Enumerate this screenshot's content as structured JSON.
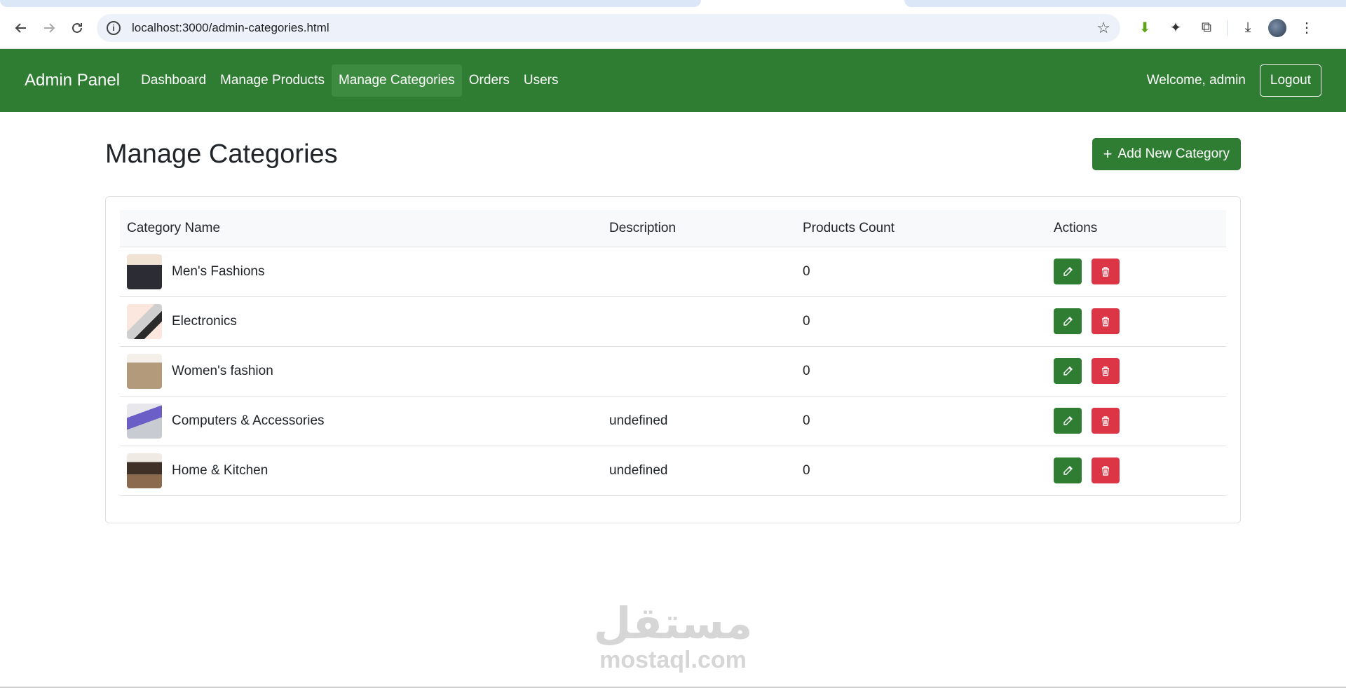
{
  "browser": {
    "url": "localhost:3000/admin-categories.html"
  },
  "navbar": {
    "brand": "Admin Panel",
    "links": [
      {
        "label": "Dashboard",
        "active": false
      },
      {
        "label": "Manage Products",
        "active": false
      },
      {
        "label": "Manage Categories",
        "active": true
      },
      {
        "label": "Orders",
        "active": false
      },
      {
        "label": "Users",
        "active": false
      }
    ],
    "welcome": "Welcome, admin",
    "logout_label": "Logout"
  },
  "page": {
    "title": "Manage Categories",
    "add_button_label": "Add New Category"
  },
  "table": {
    "headers": [
      "Category Name",
      "Description",
      "Products Count",
      "Actions"
    ],
    "rows": [
      {
        "name": "Men's Fashions",
        "description": "",
        "count": "0"
      },
      {
        "name": "Electronics",
        "description": "",
        "count": "0"
      },
      {
        "name": "Women's fashion",
        "description": "",
        "count": "0"
      },
      {
        "name": "Computers & Accessories",
        "description": "undefined",
        "count": "0"
      },
      {
        "name": "Home & Kitchen",
        "description": "undefined",
        "count": "0"
      }
    ]
  },
  "watermark": {
    "arabic": "مستقل",
    "latin": "mostaql.com"
  },
  "colors": {
    "primary": "#2e7d32",
    "danger": "#dc3545"
  }
}
